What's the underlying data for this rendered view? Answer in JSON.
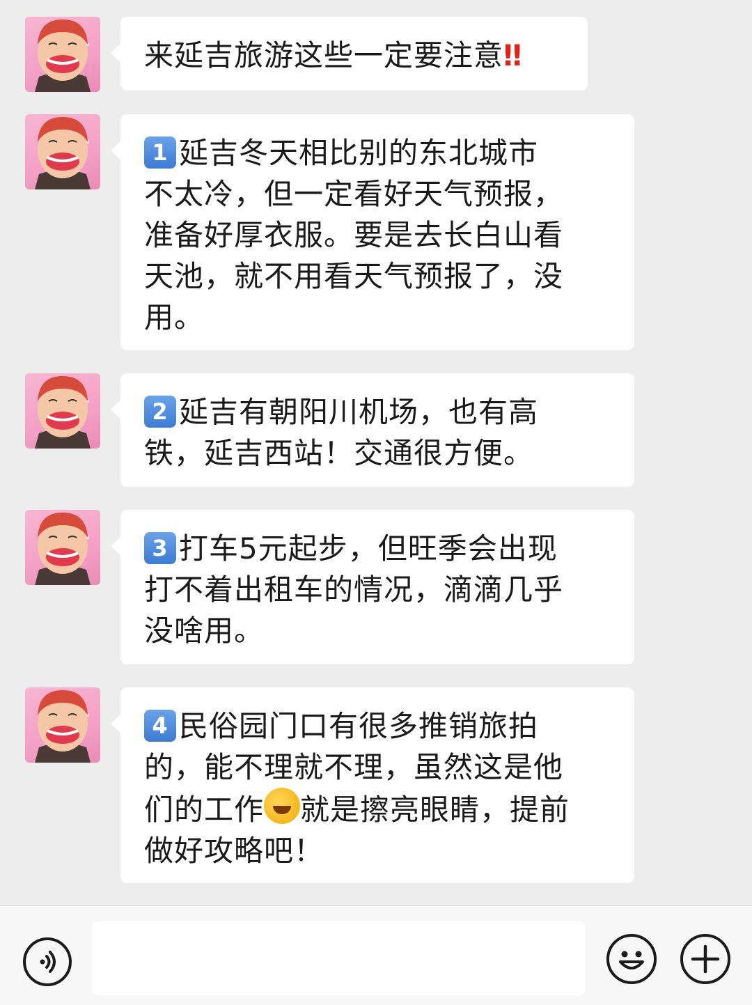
{
  "messages": [
    {
      "number": "",
      "lines": [
        "来延吉旅游这些一定要注意"
      ],
      "suffix": "‼"
    },
    {
      "number": "1",
      "lines": [
        "延吉冬天相比别的东北城市",
        "不太冷，但一定看好天气预报，",
        "准备好厚衣服。要是去长白山看",
        "天池，就不用看天气预报了，没",
        "用。"
      ]
    },
    {
      "number": "2",
      "lines": [
        "延吉有朝阳川机场，也有高",
        "铁，延吉西站！交通很方便。"
      ]
    },
    {
      "number": "3",
      "lines": [
        "打车5元起步，但旺季会出现",
        "打不着出租车的情况，滴滴几乎",
        "没啥用。"
      ]
    },
    {
      "number": "4",
      "lines": [
        "民俗园门口有很多推销旅拍",
        "的，能不理就不理，虽然这是他",
        "们的工作",
        "就是擦亮眼睛，提前",
        "做好攻略吧！"
      ]
    }
  ],
  "input": {
    "value": ""
  },
  "icons": {
    "voice": "voice-icon",
    "emoji": "smiley-icon",
    "more": "plus-icon",
    "laugh_emoji": "laughing-crying-emoji"
  },
  "colors": {
    "background": "#ededed",
    "bubble": "#ffffff",
    "number_badge": "#3b7bd4",
    "exclamation": "#e0231a"
  }
}
